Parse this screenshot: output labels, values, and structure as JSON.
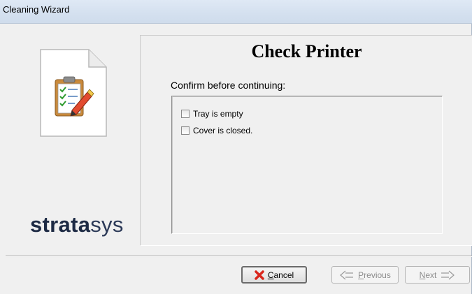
{
  "window": {
    "title": "Cleaning Wizard"
  },
  "sidebar": {
    "icon": "clipboard-checklist-icon",
    "brand_logo_bold": "strata",
    "brand_logo_thin": "sys"
  },
  "main": {
    "title": "Check Printer",
    "instruction": "Confirm before continuing:",
    "checklist": [
      {
        "label": "Tray is empty",
        "checked": false
      },
      {
        "label": "Cover is closed.",
        "checked": false
      }
    ]
  },
  "buttons": {
    "cancel": {
      "label": "Cancel",
      "icon": "red-x-icon",
      "enabled": true
    },
    "previous": {
      "label": "Previous",
      "icon": "arrow-left-icon",
      "enabled": false
    },
    "next": {
      "label": "Next",
      "icon": "arrow-right-icon",
      "enabled": false
    }
  },
  "colors": {
    "cancel_icon": "#d9261c",
    "brand": "#1d2a44"
  }
}
